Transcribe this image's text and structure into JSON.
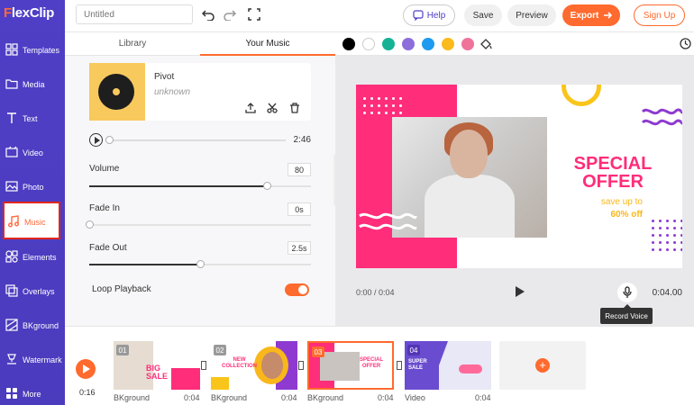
{
  "app": {
    "logo_prefix": "F",
    "logo_rest": "lexClip"
  },
  "sidebar": {
    "items": [
      {
        "label": "Templates",
        "icon": "grid-icon"
      },
      {
        "label": "Media",
        "icon": "folder-icon"
      },
      {
        "label": "Text",
        "icon": "text-icon"
      },
      {
        "label": "Video",
        "icon": "video-icon"
      },
      {
        "label": "Photo",
        "icon": "image-icon"
      },
      {
        "label": "Music",
        "icon": "music-note-icon",
        "active": true
      },
      {
        "label": "Elements",
        "icon": "shapes-icon"
      },
      {
        "label": "Overlays",
        "icon": "layers-icon"
      },
      {
        "label": "BKground",
        "icon": "background-icon"
      },
      {
        "label": "Watermark",
        "icon": "watermark-icon"
      },
      {
        "label": "More",
        "icon": "more-icon"
      }
    ]
  },
  "topbar": {
    "title_placeholder": "Untitled",
    "help_label": "Help",
    "save_label": "Save",
    "preview_label": "Preview",
    "export_label": "Export",
    "signup_label": "Sign Up"
  },
  "library": {
    "tabs": [
      "Library",
      "Your Music"
    ],
    "active_tab": 1,
    "track": {
      "name": "Pivot",
      "artist": "unknown",
      "duration": "2:46",
      "progress": 0
    },
    "volume": {
      "label": "Volume",
      "value": "80",
      "fraction": 0.8
    },
    "fade_in": {
      "label": "Fade In",
      "value": "0s",
      "fraction": 0
    },
    "fade_out": {
      "label": "Fade Out",
      "value": "2.5s",
      "fraction": 0.5
    },
    "loop": {
      "label": "Loop Playback",
      "enabled": true
    }
  },
  "palette": {
    "colors": [
      "#000000",
      "#ffffff",
      "#17b295",
      "#8c6ddb",
      "#1e9bf0",
      "#fbbb1c",
      "#f0739a"
    ]
  },
  "preview": {
    "headline_line1": "SPECIAL",
    "headline_line2": "OFFER",
    "sub_line1": "save up to",
    "sub_line2": "60% off",
    "current_time": "0:00 / 0:04",
    "total_time": "0:04.00",
    "tooltip": "Record Voice",
    "accent_pink": "#ff2d7a",
    "accent_yellow": "#f9b71b"
  },
  "timeline": {
    "time": "0:16",
    "scenes": [
      {
        "num": "01",
        "label": "BKground",
        "duration": "0:04",
        "title1": "BIG",
        "title2": "SALE"
      },
      {
        "num": "02",
        "label": "BKground",
        "duration": "0:04",
        "title1": "NEW",
        "title2": "COLLECTION"
      },
      {
        "num": "03",
        "label": "BKground",
        "duration": "0:04",
        "title1": "SPECIAL",
        "title2": "OFFER",
        "selected": true
      },
      {
        "num": "04",
        "label": "Video",
        "duration": "0:04",
        "title1": "SUPER",
        "title2": "SALE"
      }
    ]
  }
}
